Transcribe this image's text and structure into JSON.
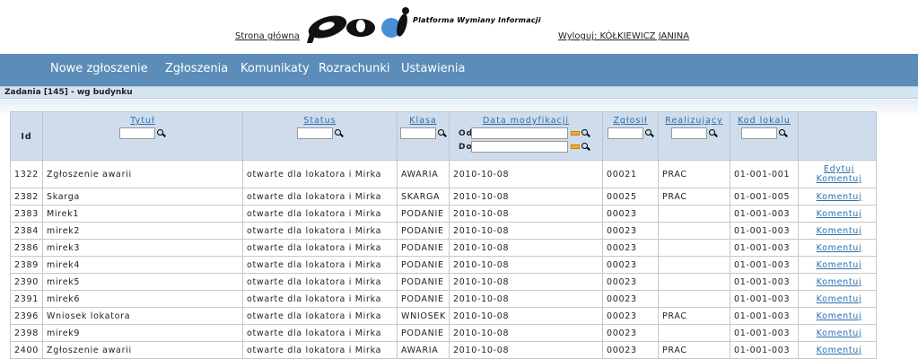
{
  "header": {
    "home_link": "Strona główna",
    "logo_text": "pwi",
    "logo_subtitle": "Platforma Wymiany Informacji",
    "logout_link": "Wyloguj: KÓŁKIEWICZ JANINA"
  },
  "nav": {
    "items": [
      "Nowe zgłoszenie",
      "Zgłoszenia",
      "Komunikaty",
      "Rozrachunki",
      "Ustawienia"
    ]
  },
  "section": {
    "title": "Zadania [145] - wg budynku"
  },
  "table": {
    "headers": {
      "id": "Id",
      "title": "Tytuł",
      "status": "Status",
      "class": "Klasa",
      "date": "Data modyfikacji",
      "date_from": "Od",
      "date_to": "Do",
      "reporter": "Zgłosił",
      "assignee": "Realizujący",
      "unit": "Kod lokalu"
    },
    "rows": [
      {
        "id": "1322",
        "title": "Zgłoszenie awarii",
        "status": "otwarte dla lokatora i Mirka",
        "class": "AWARIA",
        "date": "2010-10-08",
        "reporter": "00021",
        "assignee": "PRAC",
        "unit": "01-001-001",
        "edit": "Edytuj",
        "comment": "Komentuj"
      },
      {
        "id": "2382",
        "title": "Skarga",
        "status": "otwarte dla lokatora i Mirka",
        "class": "SKARGA",
        "date": "2010-10-08",
        "reporter": "00025",
        "assignee": "PRAC",
        "unit": "01-001-005",
        "edit": "",
        "comment": "Komentuj"
      },
      {
        "id": "2383",
        "title": "Mirek1",
        "status": "otwarte dla lokatora i Mirka",
        "class": "PODANIE",
        "date": "2010-10-08",
        "reporter": "00023",
        "assignee": "",
        "unit": "01-001-003",
        "edit": "",
        "comment": "Komentuj"
      },
      {
        "id": "2384",
        "title": "mirek2",
        "status": "otwarte dla lokatora i Mirka",
        "class": "PODANIE",
        "date": "2010-10-08",
        "reporter": "00023",
        "assignee": "",
        "unit": "01-001-003",
        "edit": "",
        "comment": "Komentuj"
      },
      {
        "id": "2386",
        "title": "mirek3",
        "status": "otwarte dla lokatora i Mirka",
        "class": "PODANIE",
        "date": "2010-10-08",
        "reporter": "00023",
        "assignee": "",
        "unit": "01-001-003",
        "edit": "",
        "comment": "Komentuj"
      },
      {
        "id": "2389",
        "title": "mirek4",
        "status": "otwarte dla lokatora i Mirka",
        "class": "PODANIE",
        "date": "2010-10-08",
        "reporter": "00023",
        "assignee": "",
        "unit": "01-001-003",
        "edit": "",
        "comment": "Komentuj"
      },
      {
        "id": "2390",
        "title": "mirek5",
        "status": "otwarte dla lokatora i Mirka",
        "class": "PODANIE",
        "date": "2010-10-08",
        "reporter": "00023",
        "assignee": "",
        "unit": "01-001-003",
        "edit": "",
        "comment": "Komentuj"
      },
      {
        "id": "2391",
        "title": "mirek6",
        "status": "otwarte dla lokatora i Mirka",
        "class": "PODANIE",
        "date": "2010-10-08",
        "reporter": "00023",
        "assignee": "",
        "unit": "01-001-003",
        "edit": "",
        "comment": "Komentuj"
      },
      {
        "id": "2396",
        "title": "Wniosek lokatora",
        "status": "otwarte dla lokatora i Mirka",
        "class": "WNIOSEK",
        "date": "2010-10-08",
        "reporter": "00023",
        "assignee": "PRAC",
        "unit": "01-001-003",
        "edit": "",
        "comment": "Komentuj"
      },
      {
        "id": "2398",
        "title": "mirek9",
        "status": "otwarte dla lokatora i Mirka",
        "class": "PODANIE",
        "date": "2010-10-08",
        "reporter": "00023",
        "assignee": "",
        "unit": "01-001-003",
        "edit": "",
        "comment": "Komentuj"
      },
      {
        "id": "2400",
        "title": "Zgłoszenie awarii",
        "status": "otwarte dla lokatora i Mirka",
        "class": "AWARIA",
        "date": "2010-10-08",
        "reporter": "00023",
        "assignee": "PRAC",
        "unit": "01-001-003",
        "edit": "",
        "comment": "Komentuj"
      }
    ]
  },
  "colors": {
    "nav_bg": "#5b8db8",
    "header_bg": "#cfdcec",
    "link": "#2a6fb0",
    "logo_accent": "#4a90d9"
  }
}
